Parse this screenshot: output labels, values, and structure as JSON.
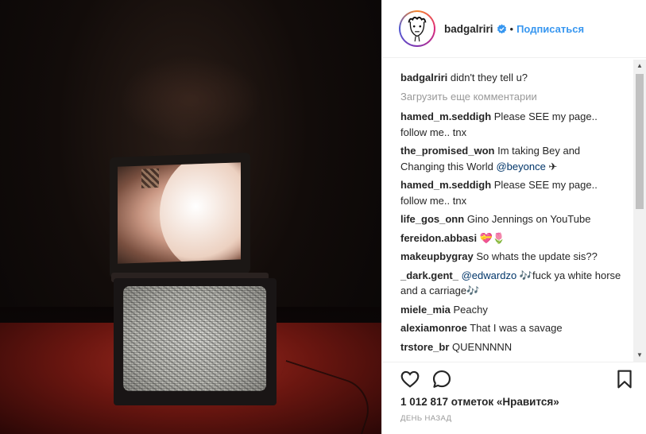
{
  "post": {
    "author": "badgalriri",
    "follow_label": "Подписаться",
    "separator": "•",
    "verified_icon": "verified-badge-icon"
  },
  "comments_section": {
    "load_more": "Загрузить еще комментарии",
    "caption": {
      "user": "badgalriri",
      "text": "didn't they tell u?"
    },
    "items": [
      {
        "user": "hamed_m.seddigh",
        "text": "Please SEE my page.. follow me.. tnx"
      },
      {
        "user": "the_promised_won",
        "text": "Im taking Bey and Changing this World",
        "mention": "@beyonce",
        "suffix": " ✈"
      },
      {
        "user": "hamed_m.seddigh",
        "text": "Please SEE my page.. follow me.. tnx"
      },
      {
        "user": "life_gos_onn",
        "text": "Gino Jennings on YouTube"
      },
      {
        "user": "fereidon.abbasi",
        "text": "💝🌷"
      },
      {
        "user": "makeupbygray",
        "text": "So whats the update sis??"
      },
      {
        "user": "_dark.gent_",
        "mention": "@edwardzo",
        "text": "🎶fuck ya white horse and a carriage🎶"
      },
      {
        "user": "miele_mia",
        "text": "Peachy"
      },
      {
        "user": "alexiamonroe",
        "text": "That I was a savage"
      },
      {
        "user": "trstore_br",
        "text": "QUENNNNN"
      }
    ]
  },
  "actions": {
    "like_icon": "heart-icon",
    "comment_icon": "comment-icon",
    "save_icon": "bookmark-icon"
  },
  "likes_text": "1 012 817 отметок «Нравится»",
  "timestamp": "ДЕНЬ НАЗАД",
  "scroll": {
    "up_glyph": "▲",
    "down_glyph": "▼"
  },
  "colors": {
    "link": "#3897f0",
    "mention": "#003569",
    "muted": "#999999"
  }
}
